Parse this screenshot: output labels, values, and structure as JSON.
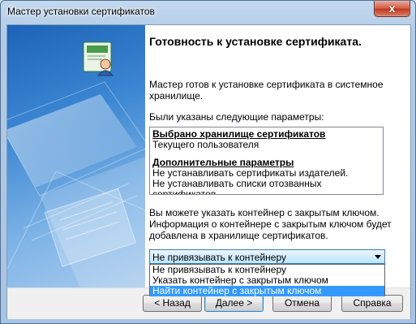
{
  "window": {
    "title": "Мастер установки сертификатов",
    "close_glyph": "x"
  },
  "wizard": {
    "heading": "Готовность к установке сертификата.",
    "intro": "Мастер готов к установке сертификата в системное хранилище.",
    "params_label": "Были указаны следующие параметры:",
    "summary": {
      "store_title": "Выбрано хранилище сертификатов",
      "store_value": "Текущего пользователя",
      "extra_title": "Дополнительные параметры",
      "extra_line1": "Не устанавливать сертификаты издателей.",
      "extra_line2": "Не устанавливать списки отозванных сертификатов."
    },
    "container_note": "Вы можете указать контейнер с закрытым ключом. Информация о контейнере с закрытым ключом будет добавлена в хранилище сертификатов.",
    "container_select": {
      "selected": "Не привязывать к контейнеру",
      "options": [
        "Не привязывать к контейнеру",
        "Указать контейнер с закрытым ключом",
        "Найти контейнер с закрытым ключом"
      ],
      "highlighted_index": 2
    }
  },
  "buttons": {
    "back": "< Назад",
    "next": "Далее >",
    "cancel": "Отмена",
    "help": "Справка"
  },
  "icons": [
    "certificate-user-icon",
    "dropdown-arrow-icon",
    "close-icon"
  ]
}
